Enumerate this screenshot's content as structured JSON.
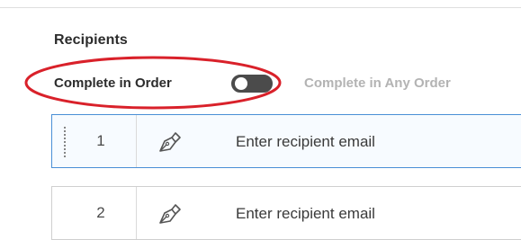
{
  "recipients": {
    "title": "Recipients",
    "order": {
      "left_label": "Complete in Order",
      "right_label": "Complete in Any Order",
      "toggle_state": "Complete in Order"
    },
    "rows": [
      {
        "number": "1",
        "placeholder": "Enter recipient email",
        "icon": "pen-icon"
      },
      {
        "number": "2",
        "placeholder": "Enter recipient email",
        "icon": "pen-icon"
      }
    ]
  },
  "colors": {
    "annotation": "#d9212a",
    "active_border": "#4a8fd6",
    "toggle": "#4b4b4b"
  }
}
